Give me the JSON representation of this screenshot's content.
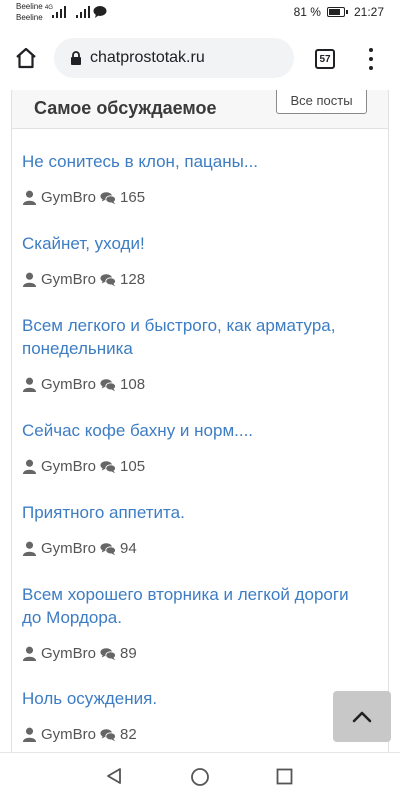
{
  "status_bar": {
    "carrier_1": "Beeline",
    "network_1": "4G",
    "carrier_2": "Beeline",
    "battery_text": "81 %",
    "battery_level": 0.81,
    "time": "21:27"
  },
  "browser": {
    "url": "chatprostotak.ru",
    "tab_count": "57"
  },
  "section": {
    "title": "Самое обсуждаемое",
    "all_posts_label": "Все посты"
  },
  "posts": [
    {
      "title": "Не сонитесь в клон, пацаны...",
      "author": "GymBro",
      "comments": "165"
    },
    {
      "title": "Скайнет, уходи!",
      "author": "GymBro",
      "comments": "128"
    },
    {
      "title": "Всем легкого и быстрого, как арматура, понедельника",
      "author": "GymBro",
      "comments": "108"
    },
    {
      "title": "Сейчас кофе бахну и норм....",
      "author": "GymBro",
      "comments": "105"
    },
    {
      "title": "Приятного аппетита.",
      "author": "GymBro",
      "comments": "94"
    },
    {
      "title": "Всем хорошего вторника и легкой дороги до Мордора.",
      "author": "GymBro",
      "comments": "89"
    },
    {
      "title": "Ноль осуждения.",
      "author": "GymBro",
      "comments": "82"
    }
  ],
  "colors": {
    "link": "#3d7dc3",
    "scroll_button": "#c8c8c8"
  }
}
